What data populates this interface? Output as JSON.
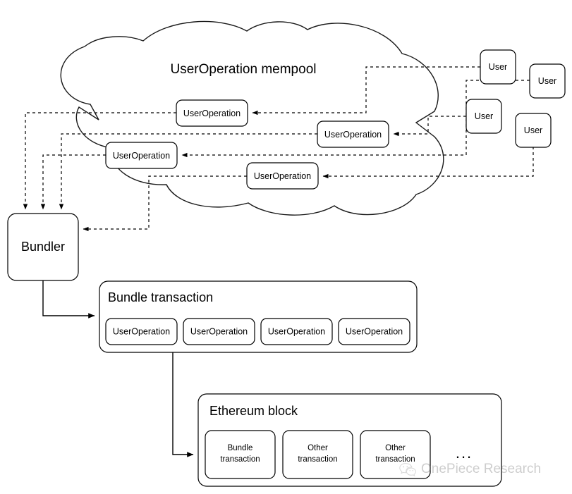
{
  "diagram": {
    "title": "UserOperation mempool",
    "mempool": {
      "label": "UserOperation mempool",
      "operations": [
        {
          "label": "UserOperation"
        },
        {
          "label": "UserOperation"
        },
        {
          "label": "UserOperation"
        },
        {
          "label": "UserOperation"
        }
      ]
    },
    "users": [
      {
        "label": "User"
      },
      {
        "label": "User"
      },
      {
        "label": "User"
      },
      {
        "label": "User"
      }
    ],
    "bundler": {
      "label": "Bundler"
    },
    "bundle_transaction": {
      "title": "Bundle transaction",
      "operations": [
        {
          "label": "UserOperation"
        },
        {
          "label": "UserOperation"
        },
        {
          "label": "UserOperation"
        },
        {
          "label": "UserOperation"
        }
      ]
    },
    "ethereum_block": {
      "title": "Ethereum block",
      "transactions": [
        {
          "line1": "Bundle",
          "line2": "transaction"
        },
        {
          "line1": "Other",
          "line2": "transaction"
        },
        {
          "line1": "Other",
          "line2": "transaction"
        }
      ],
      "ellipsis": "..."
    }
  },
  "watermark": {
    "text": "OnePiece Research",
    "icon": "wechat-icon"
  },
  "colors": {
    "stroke": "#000000",
    "background": "#ffffff",
    "watermark": "#6b6b6b"
  }
}
